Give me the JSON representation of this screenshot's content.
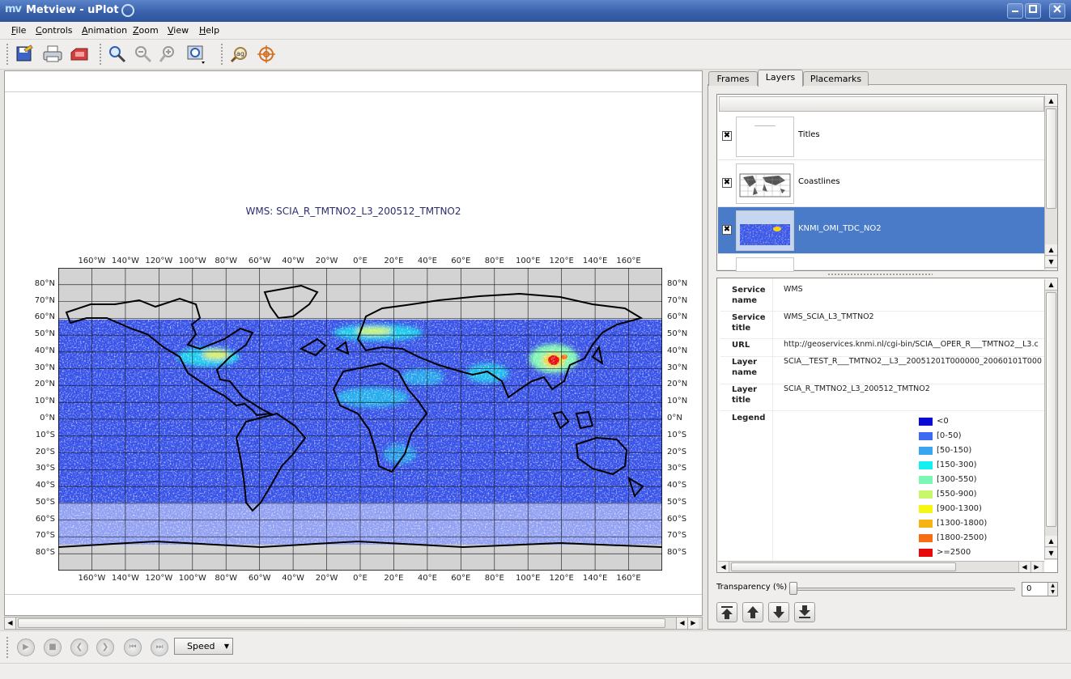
{
  "window": {
    "title": "Metview - uPlot",
    "app_icon": "mv-logo-icon",
    "buttons": [
      "minimize",
      "maximize",
      "close"
    ]
  },
  "menubar": [
    "File",
    "Controls",
    "Animation",
    "Zoom",
    "View",
    "Help"
  ],
  "toolbar": [
    "save-icon",
    "print-icon",
    "export-icon",
    "zoom-icon",
    "zoom-out-icon",
    "zoom-in-icon",
    "zoom-stack-icon",
    "magnifier-icon",
    "cursor-data-icon"
  ],
  "plot": {
    "title": "WMS: SCIA_R_TMTNO2_L3_200512_TMTNO2",
    "lon_labels": [
      "160°W",
      "140°W",
      "120°W",
      "100°W",
      "80°W",
      "60°W",
      "40°W",
      "20°W",
      "0°E",
      "20°E",
      "40°E",
      "60°E",
      "80°E",
      "100°E",
      "120°E",
      "140°E",
      "160°E"
    ],
    "lat_labels": [
      "80°N",
      "70°N",
      "60°N",
      "50°N",
      "40°N",
      "30°N",
      "20°N",
      "10°N",
      "0°N",
      "10°S",
      "20°S",
      "30°S",
      "40°S",
      "50°S",
      "60°S",
      "70°S",
      "80°S"
    ]
  },
  "animation": {
    "buttons": [
      "play",
      "stop",
      "previous",
      "next",
      "first",
      "last"
    ],
    "speed_label": "Speed"
  },
  "tabs": [
    {
      "label": "Frames",
      "active": false
    },
    {
      "label": "Layers",
      "active": true
    },
    {
      "label": "Placemarks",
      "active": false
    }
  ],
  "layers": [
    {
      "name": "Titles",
      "checked": true,
      "selected": false
    },
    {
      "name": "Coastlines",
      "checked": true,
      "selected": false
    },
    {
      "name": "KNMI_OMI_TDC_NO2",
      "checked": true,
      "selected": true
    }
  ],
  "info": {
    "service_name_label": "Service name",
    "service_name": "WMS",
    "service_title_label": "Service title",
    "service_title": "WMS_SCIA_L3_TMTNO2",
    "url_label": "URL",
    "url": "http://geoservices.knmi.nl/cgi-bin/SCIA__OPER_R___TMTNO2__L3.c",
    "layer_name_label": "Layer name",
    "layer_name": "SCIA__TEST_R___TMTNO2__L3__20051201T000000_20060101T000",
    "layer_title_label": "Layer title",
    "layer_title": "SCIA_R_TMTNO2_L3_200512_TMTNO2",
    "legend_label": "Legend"
  },
  "legend": [
    {
      "label": "<0",
      "color": "#0a0ad2"
    },
    {
      "label": "[0-50)",
      "color": "#3c6af0"
    },
    {
      "label": "[50-150)",
      "color": "#3aa6f0"
    },
    {
      "label": "[150-300)",
      "color": "#14f0f0"
    },
    {
      "label": "[300-550)",
      "color": "#7cf6b4"
    },
    {
      "label": "[550-900)",
      "color": "#c8f66c"
    },
    {
      "label": "[900-1300)",
      "color": "#f6f614"
    },
    {
      "label": "[1300-1800)",
      "color": "#f6b414"
    },
    {
      "label": "[1800-2500)",
      "color": "#f66e14"
    },
    {
      "label": ">=2500",
      "color": "#e60a0a"
    }
  ],
  "transparency": {
    "label": "Transparency (%)",
    "value": "0"
  },
  "layer_move_buttons": [
    "move-top",
    "move-up",
    "move-down",
    "move-bottom"
  ],
  "colors": {
    "titlebar": "#3a62ac",
    "selection": "#4a7bc8",
    "land": "#d3d3d3",
    "title_text": "#2b2d6e"
  }
}
